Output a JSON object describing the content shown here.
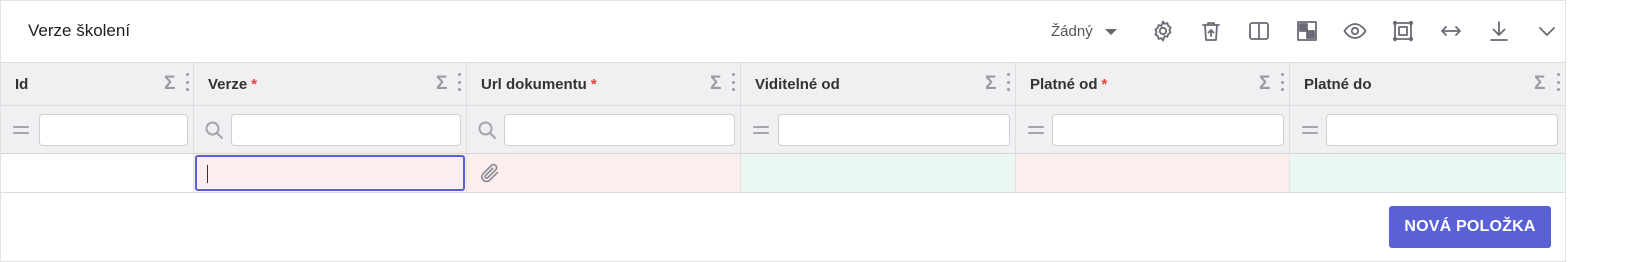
{
  "header": {
    "title": "Verze školení",
    "select_value": "Žádný",
    "toolbar_icons": [
      "gear-icon",
      "trash-restore-icon",
      "columns-icon",
      "layout-icon",
      "eye-icon",
      "frame-icon",
      "arrows-horizontal-icon",
      "download-icon",
      "chevron-down-icon"
    ]
  },
  "table": {
    "columns": [
      {
        "label": "Id",
        "required": false,
        "filter_icon": "equals-icon",
        "required_mark": ""
      },
      {
        "label": "Verze",
        "required": true,
        "filter_icon": "search-icon",
        "required_mark": "*"
      },
      {
        "label": "Url dokumentu",
        "required": true,
        "filter_icon": "search-icon",
        "required_mark": "*"
      },
      {
        "label": "Viditelné od",
        "required": false,
        "filter_icon": "equals-icon",
        "required_mark": ""
      },
      {
        "label": "Platné od",
        "required": true,
        "filter_icon": "equals-icon",
        "required_mark": "*"
      },
      {
        "label": "Platné do",
        "required": false,
        "filter_icon": "equals-icon",
        "required_mark": ""
      }
    ],
    "sigma_symbol": "Σ",
    "new_row_colors": {
      "required_empty": "#fdeeee",
      "optional": "#ebf8f2",
      "active_border": "#5860d6"
    }
  },
  "actions": {
    "new_item_label": "NOVÁ POLOŽKA"
  },
  "colors": {
    "accent": "#5a60d6",
    "header_bg": "#f0f0f3"
  }
}
